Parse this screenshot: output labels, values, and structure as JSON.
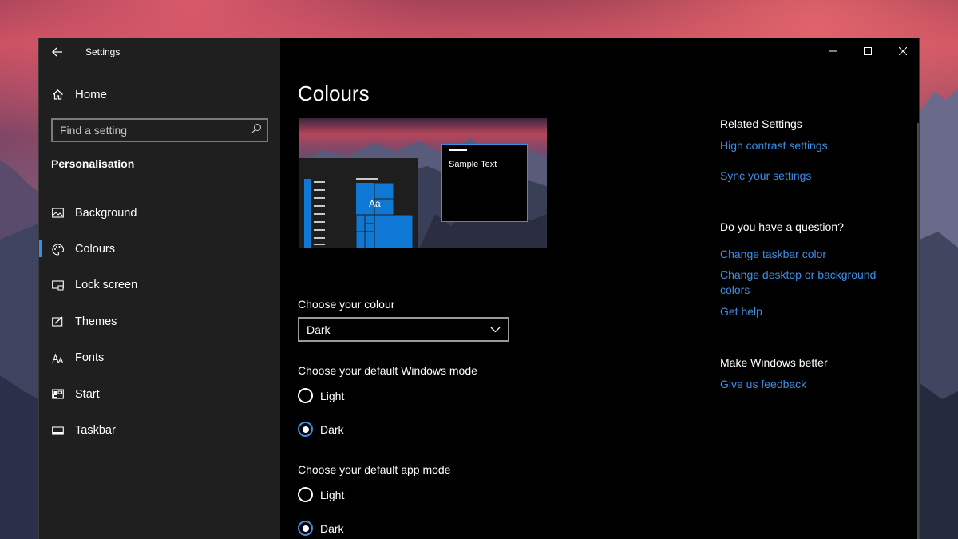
{
  "window": {
    "title": "Settings"
  },
  "sidebar": {
    "home_label": "Home",
    "search_placeholder": "Find a setting",
    "section_title": "Personalisation",
    "items": [
      {
        "label": "Background",
        "icon": "picture-icon"
      },
      {
        "label": "Colours",
        "icon": "palette-icon",
        "active": true
      },
      {
        "label": "Lock screen",
        "icon": "lock-screen-icon"
      },
      {
        "label": "Themes",
        "icon": "themes-icon"
      },
      {
        "label": "Fonts",
        "icon": "fonts-icon"
      },
      {
        "label": "Start",
        "icon": "start-icon"
      },
      {
        "label": "Taskbar",
        "icon": "taskbar-icon"
      }
    ]
  },
  "main": {
    "title": "Colours",
    "preview_sample_text": "Sample Text",
    "preview_tile_text": "Aa",
    "colour_label": "Choose your colour",
    "colour_value": "Dark",
    "windows_mode_label": "Choose your default Windows mode",
    "windows_mode_options": [
      "Light",
      "Dark"
    ],
    "windows_mode_selected": "Dark",
    "app_mode_label": "Choose your default app mode",
    "app_mode_options": [
      "Light",
      "Dark"
    ],
    "app_mode_selected": "Dark"
  },
  "related": {
    "heading": "Related Settings",
    "links": [
      "High contrast settings",
      "Sync your settings"
    ],
    "question_heading": "Do you have a question?",
    "question_links": [
      "Change taskbar color",
      "Change desktop or background colors",
      "Get help"
    ],
    "better_heading": "Make Windows better",
    "better_links": [
      "Give us feedback"
    ]
  },
  "colors": {
    "accent": "#3d8ee3",
    "sidebar_bg": "#1f1f1f",
    "content_bg": "#000000",
    "tile_blue": "#0f78d4"
  }
}
